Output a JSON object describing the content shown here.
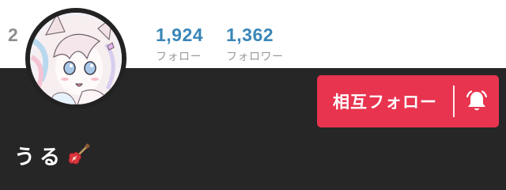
{
  "stats": [
    {
      "value": "2",
      "label": "",
      "hidden": true
    },
    {
      "value": "1,924",
      "label": "フォロー"
    },
    {
      "value": "1,362",
      "label": "フォロワー"
    }
  ],
  "colors": {
    "stat_value": "#3a86b8",
    "button_bg": "#e8344f",
    "panel_bg": "#262626"
  },
  "follow_button": {
    "label": "相互フォロー",
    "icon": "bell-icon"
  },
  "user": {
    "display_name": "うる",
    "emoji_icon": "guitar-icon"
  }
}
